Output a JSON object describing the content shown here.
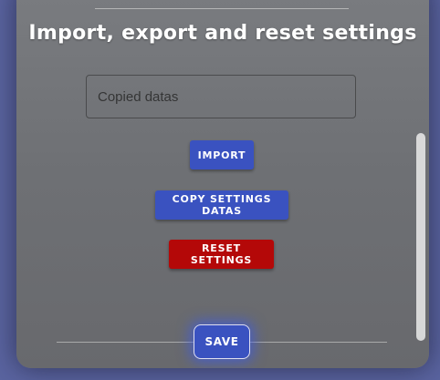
{
  "settings": {
    "section_title": "Import, export and reset settings",
    "datas_field": {
      "placeholder": "Copied datas",
      "value": ""
    },
    "buttons": {
      "import": "Import",
      "copy_settings": "Copy settings datas",
      "reset": "Reset settings",
      "save": "Save"
    }
  },
  "colors": {
    "primary": "#3a52c0",
    "danger": "#b40808",
    "panel": "#6e7074",
    "backdrop": "#5a64a0"
  }
}
